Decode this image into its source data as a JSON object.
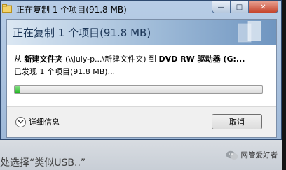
{
  "window": {
    "title": "正在复制 1 个项目(91.8 MB)",
    "minimize_glyph": "—",
    "maximize_glyph": "□",
    "close_glyph": "✕"
  },
  "dialog": {
    "header_title": "正在复制 1 个项目(91.8 MB)",
    "from_prefix": "从",
    "from_name": "新建文件夹",
    "from_path": "(\\\\july-p...\\新建文件夹)",
    "to_prefix": "到",
    "to_name": "DVD RW 驱动器 (G:...",
    "found_text": "已发现 1 个项目(91.8 MB)...",
    "progress_fraction": 0.02,
    "details_label": "详细信息",
    "cancel_label": "取消"
  },
  "background": {
    "partial_text": "处选择“类似USB..”",
    "watermark": "网管爱好者"
  },
  "colors": {
    "progress_fill": "#22b522",
    "header_text": "#1b3556"
  }
}
